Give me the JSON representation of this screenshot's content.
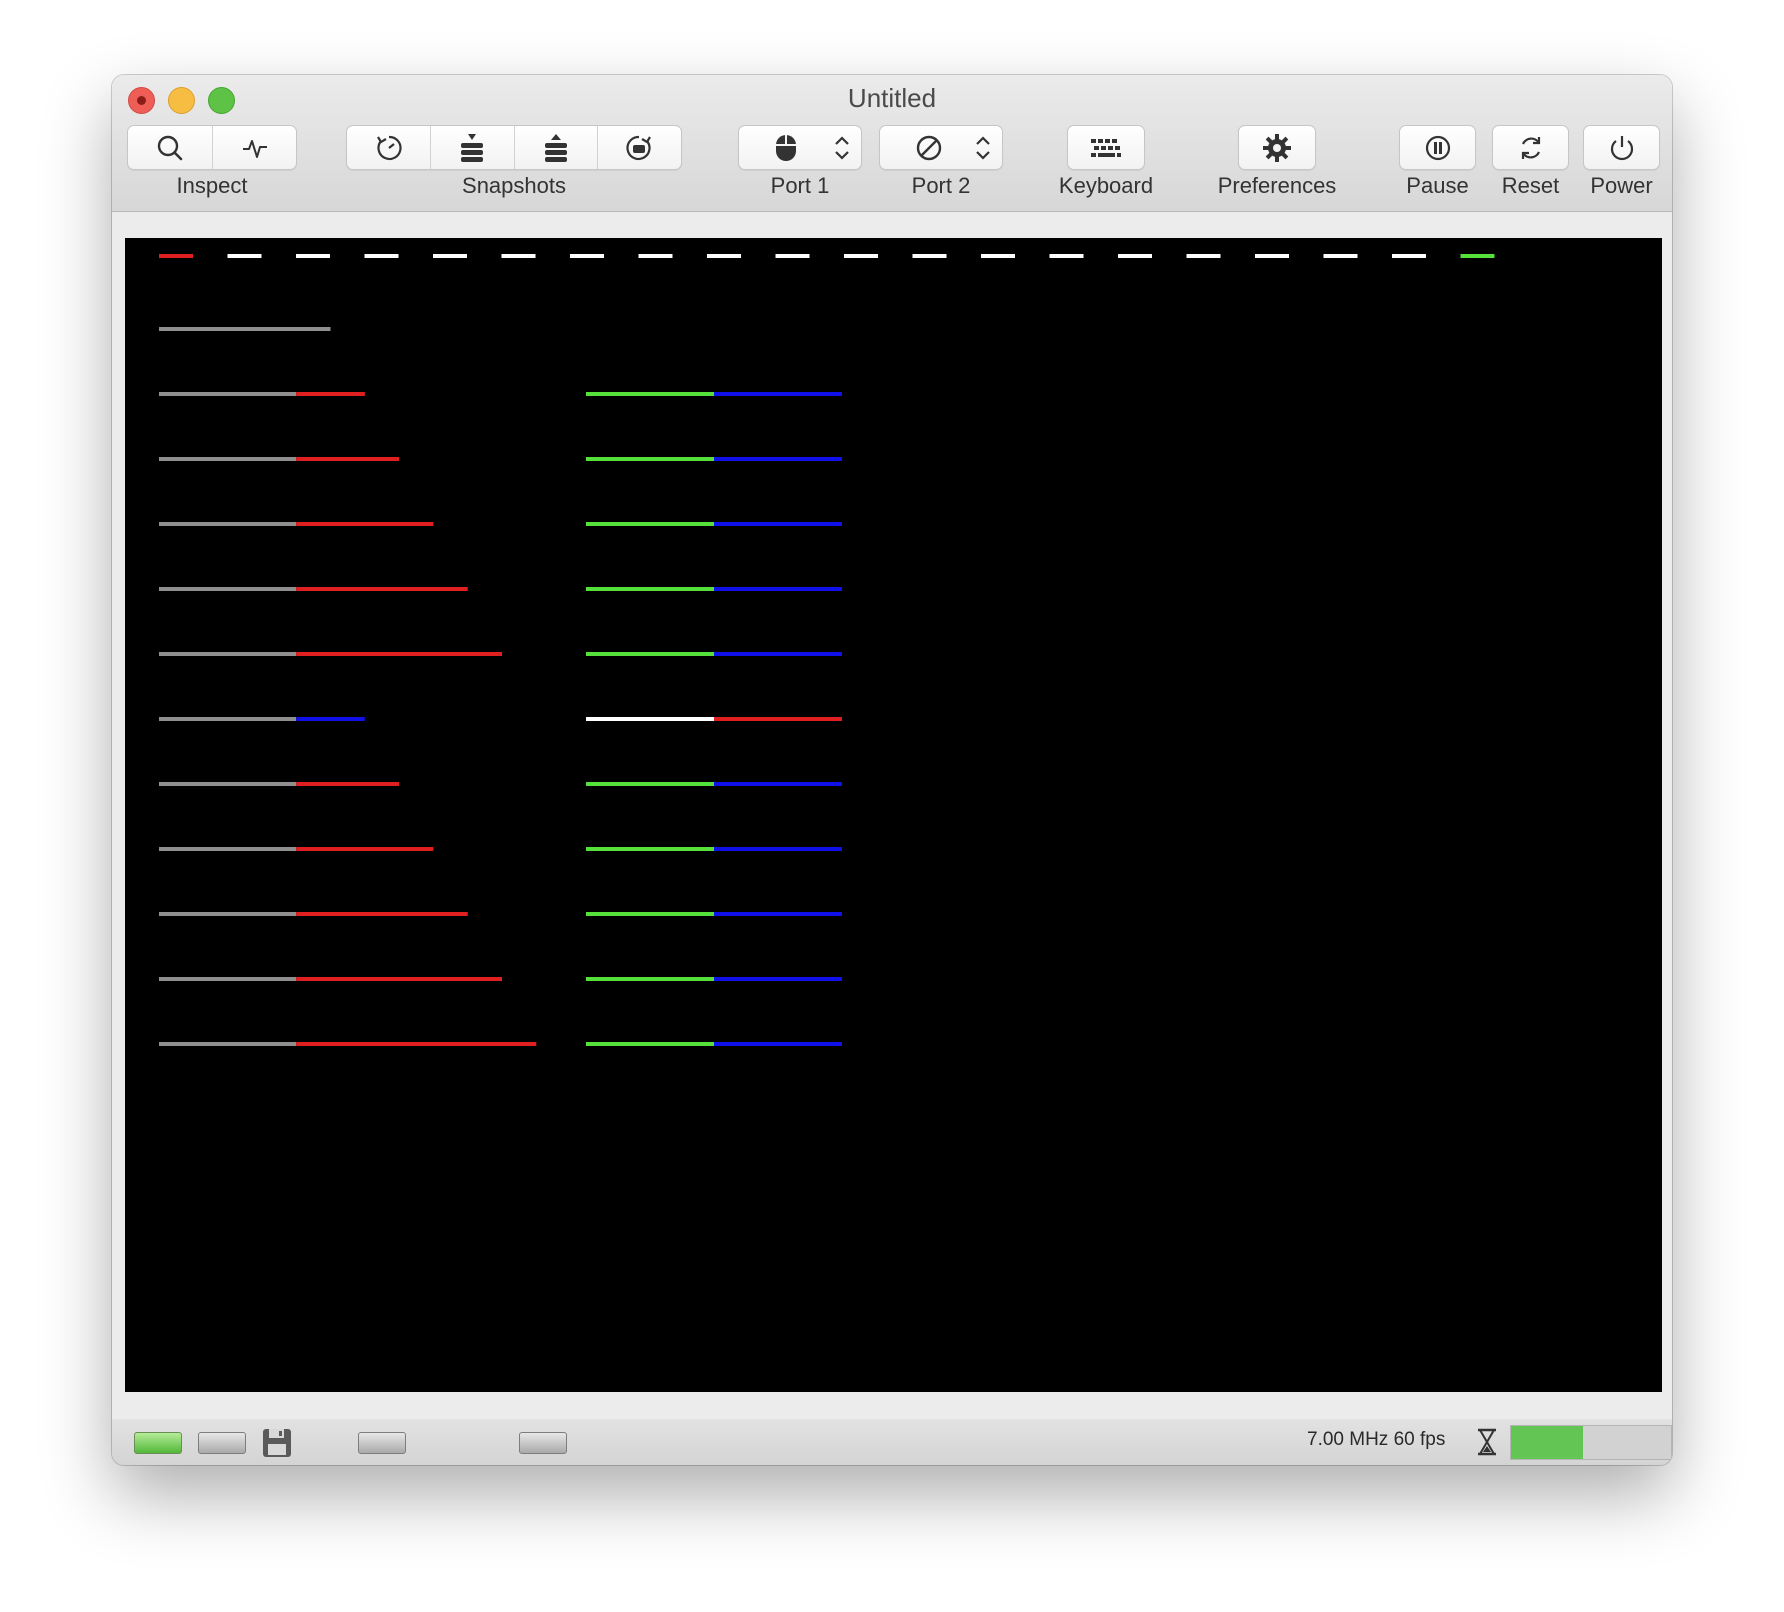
{
  "window": {
    "title": "Untitled"
  },
  "toolbar": {
    "inspect": {
      "label": "Inspect",
      "icons": [
        "search-icon",
        "pulse-icon"
      ]
    },
    "snapshots": {
      "label": "Snapshots",
      "icons": [
        "clock-arrow-icon",
        "stack-down-icon",
        "stack-up-icon",
        "restore-snapshot-icon"
      ]
    },
    "port1": {
      "label": "Port 1",
      "icon": "mouse-icon"
    },
    "port2": {
      "label": "Port 2",
      "icon": "no-device-icon"
    },
    "keyboard": {
      "label": "Keyboard",
      "icon": "keyboard-icon"
    },
    "preferences": {
      "label": "Preferences",
      "icon": "gear-icon"
    },
    "pause": {
      "label": "Pause",
      "icon": "pause-icon"
    },
    "reset": {
      "label": "Reset",
      "icon": "reset-icon"
    },
    "power": {
      "label": "Power",
      "icon": "power-icon"
    }
  },
  "screen": {
    "background": "#000000",
    "dash_colors": [
      "#e02020",
      "#ffffff",
      "#ffffff",
      "#ffffff",
      "#ffffff",
      "#ffffff",
      "#ffffff",
      "#ffffff",
      "#ffffff",
      "#ffffff",
      "#ffffff",
      "#ffffff",
      "#ffffff",
      "#ffffff",
      "#ffffff",
      "#ffffff",
      "#ffffff",
      "#ffffff",
      "#ffffff",
      "#55e03a"
    ],
    "left_rows": [
      [
        [
          "#8f8f8f",
          5
        ]
      ],
      [
        [
          "#8f8f8f",
          4
        ],
        [
          "#e02020",
          2
        ]
      ],
      [
        [
          "#8f8f8f",
          4
        ],
        [
          "#e02020",
          3
        ]
      ],
      [
        [
          "#8f8f8f",
          4
        ],
        [
          "#e02020",
          4
        ]
      ],
      [
        [
          "#8f8f8f",
          4
        ],
        [
          "#e02020",
          5
        ]
      ],
      [
        [
          "#8f8f8f",
          4
        ],
        [
          "#e02020",
          6
        ]
      ],
      [
        [
          "#8f8f8f",
          4
        ],
        [
          "#1010e8",
          2
        ]
      ],
      [
        [
          "#8f8f8f",
          4
        ],
        [
          "#e02020",
          3
        ]
      ],
      [
        [
          "#8f8f8f",
          4
        ],
        [
          "#e02020",
          4
        ]
      ],
      [
        [
          "#8f8f8f",
          4
        ],
        [
          "#e02020",
          5
        ]
      ],
      [
        [
          "#8f8f8f",
          4
        ],
        [
          "#e02020",
          6
        ]
      ],
      [
        [
          "#8f8f8f",
          4
        ],
        [
          "#e02020",
          7
        ]
      ]
    ],
    "right_rows": [
      null,
      [
        [
          "#55e03a",
          1
        ],
        [
          "#1010e8",
          1
        ]
      ],
      [
        [
          "#55e03a",
          1
        ],
        [
          "#1010e8",
          1
        ]
      ],
      [
        [
          "#55e03a",
          1
        ],
        [
          "#1010e8",
          1
        ]
      ],
      [
        [
          "#55e03a",
          1
        ],
        [
          "#1010e8",
          1
        ]
      ],
      [
        [
          "#55e03a",
          1
        ],
        [
          "#1010e8",
          1
        ]
      ],
      [
        [
          "#ffffff",
          1
        ],
        [
          "#e02020",
          1
        ]
      ],
      [
        [
          "#55e03a",
          1
        ],
        [
          "#1010e8",
          1
        ]
      ],
      [
        [
          "#55e03a",
          1
        ],
        [
          "#1010e8",
          1
        ]
      ],
      [
        [
          "#55e03a",
          1
        ],
        [
          "#1010e8",
          1
        ]
      ],
      [
        [
          "#55e03a",
          1
        ],
        [
          "#1010e8",
          1
        ]
      ],
      [
        [
          "#55e03a",
          1
        ],
        [
          "#1010e8",
          1
        ]
      ]
    ]
  },
  "statusbar": {
    "drives": [
      "drive-led-icon",
      "drive-icon",
      "floppy-disk-icon",
      "drive-icon",
      "drive-icon"
    ],
    "speed_text": "7.00 MHz 60 fps",
    "speed_icon": "hourglass-icon",
    "speed_fill": 0.45,
    "speed_color": "#62c554"
  }
}
